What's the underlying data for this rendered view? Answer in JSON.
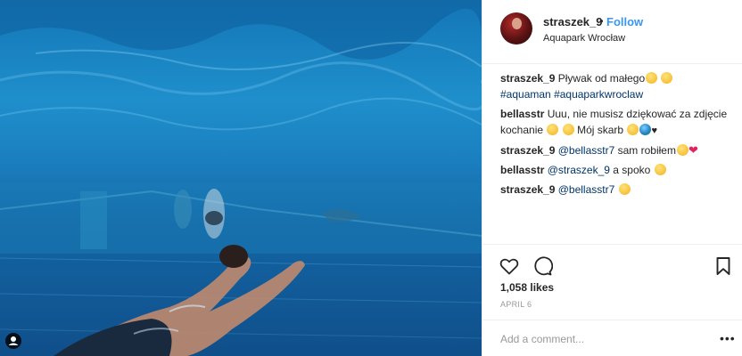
{
  "post": {
    "author": {
      "username": "straszek_9",
      "separator": "•",
      "follow_label": "Follow",
      "location": "Aquapark Wrocław"
    },
    "comments": [
      {
        "user": "straszek_9",
        "text": "Pływak od małego",
        "emojis": [
          "smiling-face-with-halo-emoji",
          "smiling-face-with-sunglasses-emoji"
        ],
        "tags": [
          "#aquaman",
          "#aquaparkwroclaw"
        ]
      },
      {
        "user": "bellasstr",
        "text": "Uuu, nie musisz dziękować za zdjęcie kochanie",
        "emojis_mid": [
          "smirking-face-emoji",
          "grinning-face-emoji"
        ],
        "text2": "Mój skarb",
        "emojis_end": [
          "hand-over-mouth-emoji",
          "globe-emoji",
          "black-heart-emoji"
        ],
        "heart_glyph": "♥"
      },
      {
        "user": "straszek_9",
        "mention": "@bellasstr7",
        "text": "sam robiłem",
        "emojis": [
          "smiling-face-with-halo-emoji",
          "red-heart-emoji"
        ],
        "heart_glyph": "❤"
      },
      {
        "user": "bellasstr",
        "mention": "@straszek_9",
        "text": "a spoko",
        "emojis": [
          "pensive-face-emoji"
        ]
      },
      {
        "user": "straszek_9",
        "mention": "@bellasstr7",
        "emojis": [
          "disappointed-face-emoji"
        ]
      }
    ],
    "likes": "1,058 likes",
    "date": "APRIL 6",
    "add_comment_placeholder": "Add a comment...",
    "more_glyph": "•••"
  },
  "colors": {
    "link": "#003569",
    "follow": "#3897f0",
    "muted": "#999999",
    "water_top": "#1f8fcc",
    "water_bottom": "#0f4f8a"
  }
}
